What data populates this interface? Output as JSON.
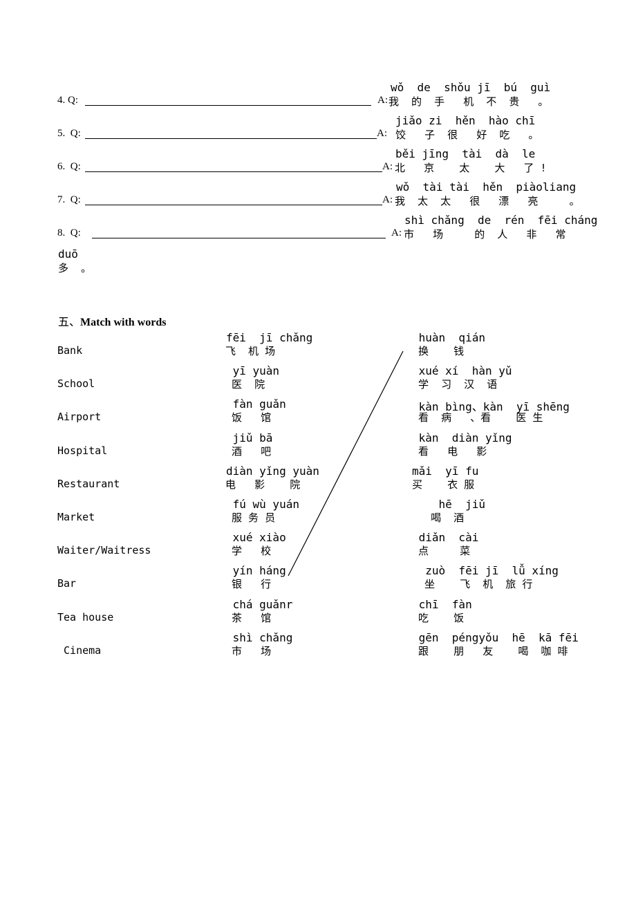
{
  "questions": [
    {
      "label": "4. Q:",
      "answer_prefix": "A:",
      "pinyin": "wǒ  de  shǒu jī  bú  guì",
      "hanzi": "我  的  手   机  不  贵   。"
    },
    {
      "label": "5.  Q:",
      "answer_prefix": "A:",
      "pinyin": "jiǎo zi  hěn  hào chī",
      "hanzi": " 饺   子  很   好  吃   。"
    },
    {
      "label": "6.  Q:",
      "answer_prefix": "A:",
      "pinyin": "běi jīng  tài  dà  le",
      "hanzi": "北   京    太    大   了 !"
    },
    {
      "label": "7.  Q:",
      "answer_prefix": "A:",
      "pinyin": "wǒ  tài tài  hěn  piàoliang",
      "hanzi": "我  太  太   很   漂   亮     。"
    },
    {
      "label": "8.  Q:",
      "answer_prefix": "A:",
      "pinyin": "shì chǎng  de  rén  fēi cháng",
      "hanzi": "市   场     的  人   非   常"
    }
  ],
  "continuation": {
    "pinyin": "duō",
    "hanzi": "多  。"
  },
  "section": {
    "number": "五、",
    "title": "Match with words"
  },
  "match": {
    "english": [
      "Bank",
      "School",
      "Airport",
      "Hospital",
      "Restaurant",
      "Market",
      "Waiter/Waitress",
      "Bar",
      "Tea house",
      " Cinema"
    ],
    "places": [
      {
        "pinyin": "fēi  jī chǎng",
        "hanzi": "飞  机 场"
      },
      {
        "pinyin": " yī yuàn",
        "hanzi": " 医  院"
      },
      {
        "pinyin": " fàn guǎn",
        "hanzi": " 饭   馆"
      },
      {
        "pinyin": " jiǔ bā",
        "hanzi": " 酒   吧"
      },
      {
        "pinyin": "diàn yǐng yuàn",
        "hanzi": "电   影    院"
      },
      {
        "pinyin": " fú wù yuán",
        "hanzi": " 服 务 员"
      },
      {
        "pinyin": " xué xiào",
        "hanzi": " 学   校"
      },
      {
        "pinyin": " yín háng",
        "hanzi": " 银   行"
      },
      {
        "pinyin": " chá guǎnr",
        "hanzi": " 茶   馆"
      },
      {
        "pinyin": " shì chǎng",
        "hanzi": " 市   场"
      }
    ],
    "activities": [
      {
        "pinyin": " huàn  qián",
        "hanzi": " 换    钱"
      },
      {
        "pinyin": " xué xí  hàn yǔ",
        "hanzi": " 学  习  汉  语"
      },
      {
        "pinyin": " kàn bìng、kàn  yī shēng",
        "hanzi": " 看  病   、看    医 生"
      },
      {
        "pinyin": " kàn  diàn yǐng",
        "hanzi": " 看   电   影"
      },
      {
        "pinyin": "mǎi  yī fu",
        "hanzi": "买    衣 服"
      },
      {
        "pinyin": "    hē  jiǔ",
        "hanzi": "   喝  酒"
      },
      {
        "pinyin": " diǎn  cài",
        "hanzi": " 点     菜"
      },
      {
        "pinyin": "  zuò  fēi jī  lǚ xíng",
        "hanzi": "  坐    飞  机  旅 行"
      },
      {
        "pinyin": " chī  fàn",
        "hanzi": " 吃    饭"
      },
      {
        "pinyin": " gēn  péngyǒu  hē  kā fēi",
        "hanzi": " 跟    朋   友    喝  咖 啡"
      }
    ],
    "drawn_match": {
      "from": "yín háng 银行",
      "to": "huàn qián 换钱"
    }
  }
}
